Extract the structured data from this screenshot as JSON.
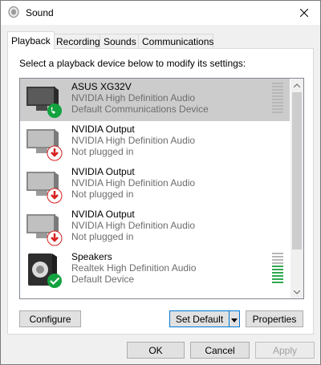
{
  "window": {
    "title": "Sound"
  },
  "tabs": [
    {
      "label": "Playback",
      "active": true
    },
    {
      "label": "Recording",
      "active": false
    },
    {
      "label": "Sounds",
      "active": false
    },
    {
      "label": "Communications",
      "active": false
    }
  ],
  "playback": {
    "instruction": "Select a playback device below to modify its settings:",
    "devices": [
      {
        "name": "ASUS XG32V",
        "driver": "NVIDIA High Definition Audio",
        "status": "Default Communications Device",
        "icon": "monitor-icon",
        "badge": "phone-badge-icon",
        "selected": true,
        "level": 0
      },
      {
        "name": "NVIDIA Output",
        "driver": "NVIDIA High Definition Audio",
        "status": "Not plugged in",
        "icon": "monitor-icon",
        "badge": "unplugged-badge-icon",
        "selected": false
      },
      {
        "name": "NVIDIA Output",
        "driver": "NVIDIA High Definition Audio",
        "status": "Not plugged in",
        "icon": "monitor-icon",
        "badge": "unplugged-badge-icon",
        "selected": false
      },
      {
        "name": "NVIDIA Output",
        "driver": "NVIDIA High Definition Audio",
        "status": "Not plugged in",
        "icon": "monitor-icon",
        "badge": "unplugged-badge-icon",
        "selected": false
      },
      {
        "name": "Speakers",
        "driver": "Realtek High Definition Audio",
        "status": "Default Device",
        "icon": "speaker-icon",
        "badge": "default-check-badge-icon",
        "selected": false,
        "level": 0.6
      }
    ],
    "configure_label": "Configure",
    "set_default_label": "Set Default",
    "properties_label": "Properties"
  },
  "footer": {
    "ok_label": "OK",
    "cancel_label": "Cancel",
    "apply_label": "Apply"
  },
  "colors": {
    "selection": "#cccccc",
    "check_green": "#12a23f",
    "unplug_red": "#d81f1f",
    "level_green": "#2fa84f",
    "accent": "#0078d7"
  }
}
